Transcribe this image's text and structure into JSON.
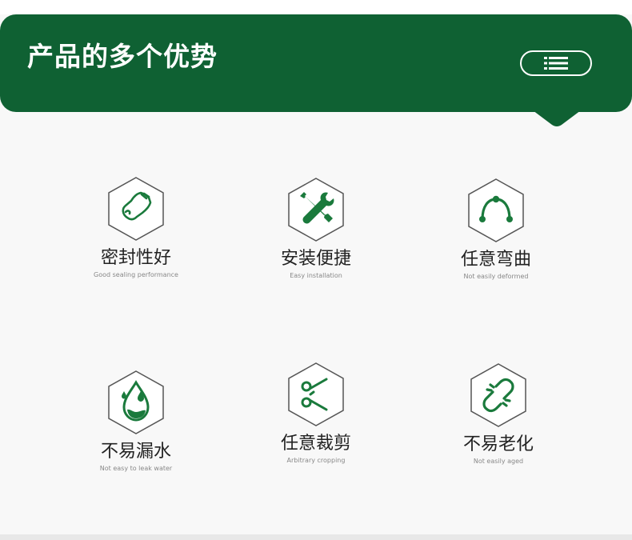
{
  "header": {
    "title": "产品的多个优势",
    "menu_icon": "list-icon"
  },
  "colors": {
    "brand": "#0f6133",
    "icon": "#1a7a3c",
    "text": "#222222",
    "subtext": "#888888"
  },
  "features": [
    {
      "title": "密封性好",
      "subtitle": "Good sealing performance",
      "icon": "seal-hose-icon"
    },
    {
      "title": "安装便捷",
      "subtitle": "Easy installation",
      "icon": "wrench-screwdriver-icon"
    },
    {
      "title": "任意弯曲",
      "subtitle": "Not easily deformed",
      "icon": "bend-arc-icon"
    },
    {
      "title": "不易漏水",
      "subtitle": "Not easy to leak water",
      "icon": "water-drop-icon"
    },
    {
      "title": "任意裁剪",
      "subtitle": "Arbitrary cropping",
      "icon": "scissors-icon"
    },
    {
      "title": "不易老化",
      "subtitle": "Not easily aged",
      "icon": "broken-link-icon"
    }
  ]
}
